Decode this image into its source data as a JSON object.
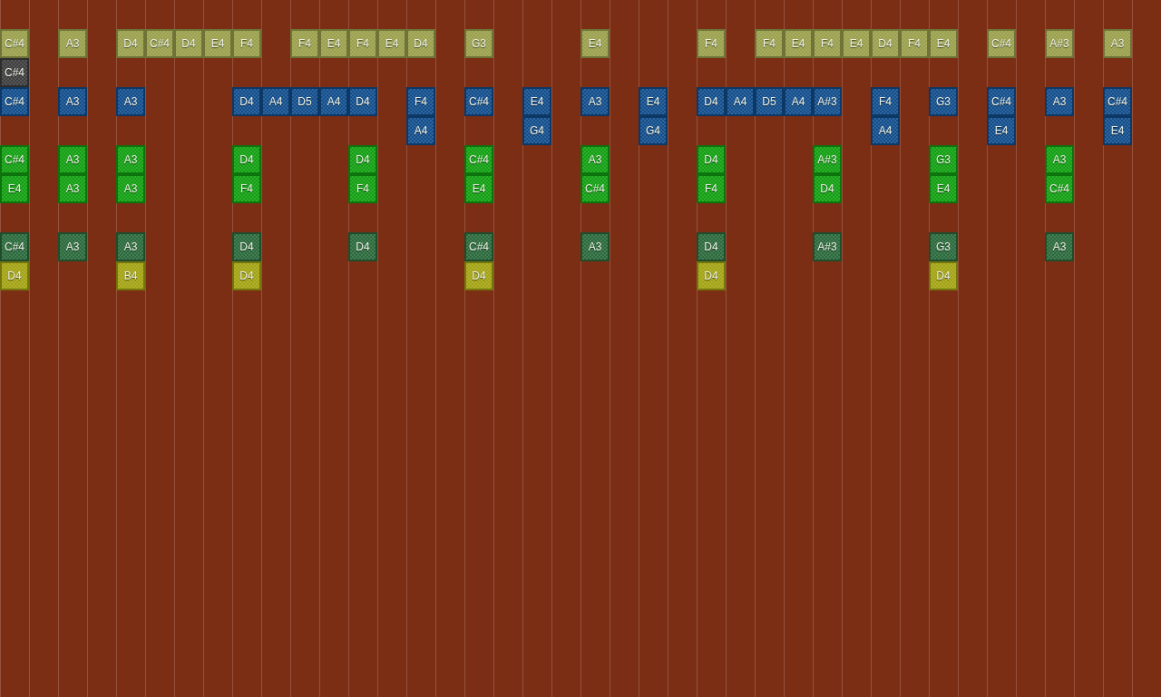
{
  "tracks": [
    {
      "color": "#9aa04c",
      "notes": [
        {
          "kind": "note",
          "pitch": "C#4"
        },
        {
          "kind": "rest"
        },
        {
          "kind": "note",
          "pitch": "A3"
        },
        {
          "kind": "rest"
        },
        {
          "kind": "note",
          "pitch": "D4"
        },
        {
          "kind": "note",
          "pitch": "C#4"
        },
        {
          "kind": "note",
          "pitch": "D4"
        },
        {
          "kind": "note",
          "pitch": "E4"
        },
        {
          "kind": "note",
          "pitch": "F4"
        },
        {
          "kind": "rest"
        },
        {
          "kind": "note",
          "pitch": "F4"
        },
        {
          "kind": "note",
          "pitch": "E4"
        },
        {
          "kind": "note",
          "pitch": "F4"
        },
        {
          "kind": "note",
          "pitch": "E4"
        },
        {
          "kind": "note",
          "pitch": "D4"
        },
        {
          "kind": "rest"
        },
        {
          "kind": "note",
          "pitch": "G3"
        },
        {
          "kind": "rest"
        },
        {
          "kind": "rest"
        },
        {
          "kind": "rest"
        },
        {
          "kind": "note",
          "pitch": "E4"
        },
        {
          "kind": "rest"
        },
        {
          "kind": "rest"
        },
        {
          "kind": "rest"
        },
        {
          "kind": "note",
          "pitch": "F4"
        },
        {
          "kind": "rest"
        },
        {
          "kind": "note",
          "pitch": "F4"
        },
        {
          "kind": "note",
          "pitch": "E4"
        },
        {
          "kind": "note",
          "pitch": "F4"
        },
        {
          "kind": "note",
          "pitch": "E4"
        },
        {
          "kind": "note",
          "pitch": "D4"
        },
        {
          "kind": "note",
          "pitch": "F4"
        },
        {
          "kind": "note",
          "pitch": "E4"
        },
        {
          "kind": "rest"
        },
        {
          "kind": "note",
          "pitch": "C#4"
        },
        {
          "kind": "rest"
        },
        {
          "kind": "note",
          "pitch": "A#3"
        },
        {
          "kind": "rest"
        },
        {
          "kind": "note",
          "pitch": "A3"
        }
      ]
    },
    {
      "color": "#3e3e3e",
      "notes": [
        {
          "kind": "note",
          "pitch": "C#4"
        }
      ]
    },
    {
      "color": "#124e8c",
      "notes": [
        {
          "kind": "note",
          "pitch": "C#4"
        },
        {
          "kind": "rest"
        },
        {
          "kind": "note",
          "pitch": "A3"
        },
        {
          "kind": "rest"
        },
        {
          "kind": "note",
          "pitch": "A3"
        },
        {
          "kind": "rest"
        },
        {
          "kind": "rest"
        },
        {
          "kind": "rest"
        },
        {
          "kind": "note",
          "pitch": "D4"
        },
        {
          "kind": "note",
          "pitch": "A4"
        },
        {
          "kind": "note",
          "pitch": "D5"
        },
        {
          "kind": "note",
          "pitch": "A4"
        },
        {
          "kind": "note",
          "pitch": "D4"
        },
        {
          "kind": "rest"
        },
        {
          "kind": "note",
          "pitch": "F4"
        },
        {
          "kind": "rest"
        },
        {
          "kind": "note",
          "pitch": "C#4"
        },
        {
          "kind": "rest"
        },
        {
          "kind": "note",
          "pitch": "E4"
        },
        {
          "kind": "rest"
        },
        {
          "kind": "note",
          "pitch": "A3"
        },
        {
          "kind": "rest"
        },
        {
          "kind": "note",
          "pitch": "E4"
        },
        {
          "kind": "rest"
        },
        {
          "kind": "note",
          "pitch": "D4"
        },
        {
          "kind": "note",
          "pitch": "A4"
        },
        {
          "kind": "note",
          "pitch": "D5"
        },
        {
          "kind": "note",
          "pitch": "A4"
        },
        {
          "kind": "note",
          "pitch": "A#3"
        },
        {
          "kind": "rest"
        },
        {
          "kind": "note",
          "pitch": "F4"
        },
        {
          "kind": "rest"
        },
        {
          "kind": "note",
          "pitch": "G3"
        },
        {
          "kind": "rest"
        },
        {
          "kind": "note",
          "pitch": "C#4"
        },
        {
          "kind": "rest"
        },
        {
          "kind": "note",
          "pitch": "A3"
        },
        {
          "kind": "rest"
        },
        {
          "kind": "note",
          "pitch": "C#4"
        }
      ]
    },
    {
      "color": "#124e8c",
      "notes": [
        {
          "kind": "rest"
        },
        {
          "kind": "rest"
        },
        {
          "kind": "rest"
        },
        {
          "kind": "rest"
        },
        {
          "kind": "rest"
        },
        {
          "kind": "rest"
        },
        {
          "kind": "rest"
        },
        {
          "kind": "rest"
        },
        {
          "kind": "rest"
        },
        {
          "kind": "rest"
        },
        {
          "kind": "rest"
        },
        {
          "kind": "rest"
        },
        {
          "kind": "rest"
        },
        {
          "kind": "rest"
        },
        {
          "kind": "note",
          "pitch": "A4"
        },
        {
          "kind": "rest"
        },
        {
          "kind": "rest"
        },
        {
          "kind": "rest"
        },
        {
          "kind": "note",
          "pitch": "G4"
        },
        {
          "kind": "rest"
        },
        {
          "kind": "rest"
        },
        {
          "kind": "rest"
        },
        {
          "kind": "note",
          "pitch": "G4"
        },
        {
          "kind": "rest"
        },
        {
          "kind": "rest"
        },
        {
          "kind": "rest"
        },
        {
          "kind": "rest"
        },
        {
          "kind": "rest"
        },
        {
          "kind": "rest"
        },
        {
          "kind": "rest"
        },
        {
          "kind": "note",
          "pitch": "A4"
        },
        {
          "kind": "rest"
        },
        {
          "kind": "rest"
        },
        {
          "kind": "rest"
        },
        {
          "kind": "note",
          "pitch": "E4"
        },
        {
          "kind": "rest"
        },
        {
          "kind": "rest"
        },
        {
          "kind": "rest"
        },
        {
          "kind": "note",
          "pitch": "E4"
        }
      ]
    },
    {
      "color": "#12a012",
      "notes": [
        {
          "kind": "note",
          "pitch": "C#4"
        },
        {
          "kind": "rest"
        },
        {
          "kind": "note",
          "pitch": "A3"
        },
        {
          "kind": "rest"
        },
        {
          "kind": "note",
          "pitch": "A3"
        },
        {
          "kind": "rest"
        },
        {
          "kind": "rest"
        },
        {
          "kind": "rest"
        },
        {
          "kind": "note",
          "pitch": "D4"
        },
        {
          "kind": "rest"
        },
        {
          "kind": "rest"
        },
        {
          "kind": "rest"
        },
        {
          "kind": "note",
          "pitch": "D4"
        },
        {
          "kind": "rest"
        },
        {
          "kind": "rest"
        },
        {
          "kind": "rest"
        },
        {
          "kind": "note",
          "pitch": "C#4"
        },
        {
          "kind": "rest"
        },
        {
          "kind": "rest"
        },
        {
          "kind": "rest"
        },
        {
          "kind": "note",
          "pitch": "A3"
        },
        {
          "kind": "rest"
        },
        {
          "kind": "rest"
        },
        {
          "kind": "rest"
        },
        {
          "kind": "note",
          "pitch": "D4"
        },
        {
          "kind": "rest"
        },
        {
          "kind": "rest"
        },
        {
          "kind": "rest"
        },
        {
          "kind": "note",
          "pitch": "A#3"
        },
        {
          "kind": "rest"
        },
        {
          "kind": "rest"
        },
        {
          "kind": "rest"
        },
        {
          "kind": "note",
          "pitch": "G3"
        },
        {
          "kind": "rest"
        },
        {
          "kind": "rest"
        },
        {
          "kind": "rest"
        },
        {
          "kind": "note",
          "pitch": "A3"
        }
      ]
    },
    {
      "color": "#12a012",
      "notes": [
        {
          "kind": "note",
          "pitch": "E4"
        },
        {
          "kind": "rest"
        },
        {
          "kind": "note",
          "pitch": "A3"
        },
        {
          "kind": "rest"
        },
        {
          "kind": "note",
          "pitch": "A3"
        },
        {
          "kind": "rest"
        },
        {
          "kind": "rest"
        },
        {
          "kind": "rest"
        },
        {
          "kind": "note",
          "pitch": "F4"
        },
        {
          "kind": "rest"
        },
        {
          "kind": "rest"
        },
        {
          "kind": "rest"
        },
        {
          "kind": "note",
          "pitch": "F4"
        },
        {
          "kind": "rest"
        },
        {
          "kind": "rest"
        },
        {
          "kind": "rest"
        },
        {
          "kind": "note",
          "pitch": "E4"
        },
        {
          "kind": "rest"
        },
        {
          "kind": "rest"
        },
        {
          "kind": "rest"
        },
        {
          "kind": "note",
          "pitch": "C#4"
        },
        {
          "kind": "rest"
        },
        {
          "kind": "rest"
        },
        {
          "kind": "rest"
        },
        {
          "kind": "note",
          "pitch": "F4"
        },
        {
          "kind": "rest"
        },
        {
          "kind": "rest"
        },
        {
          "kind": "rest"
        },
        {
          "kind": "note",
          "pitch": "D4"
        },
        {
          "kind": "rest"
        },
        {
          "kind": "rest"
        },
        {
          "kind": "rest"
        },
        {
          "kind": "note",
          "pitch": "E4"
        },
        {
          "kind": "rest"
        },
        {
          "kind": "rest"
        },
        {
          "kind": "rest"
        },
        {
          "kind": "note",
          "pitch": "C#4"
        }
      ]
    },
    {
      "notes": [
        {
          "kind": "rest"
        }
      ]
    },
    {
      "color": "#2b6a3c",
      "notes": [
        {
          "kind": "note",
          "pitch": "C#4"
        },
        {
          "kind": "rest"
        },
        {
          "kind": "note",
          "pitch": "A3"
        },
        {
          "kind": "rest"
        },
        {
          "kind": "note",
          "pitch": "A3"
        },
        {
          "kind": "rest"
        },
        {
          "kind": "rest"
        },
        {
          "kind": "rest"
        },
        {
          "kind": "note",
          "pitch": "D4"
        },
        {
          "kind": "rest"
        },
        {
          "kind": "rest"
        },
        {
          "kind": "rest"
        },
        {
          "kind": "note",
          "pitch": "D4"
        },
        {
          "kind": "rest"
        },
        {
          "kind": "rest"
        },
        {
          "kind": "rest"
        },
        {
          "kind": "note",
          "pitch": "C#4"
        },
        {
          "kind": "rest"
        },
        {
          "kind": "rest"
        },
        {
          "kind": "rest"
        },
        {
          "kind": "note",
          "pitch": "A3"
        },
        {
          "kind": "rest"
        },
        {
          "kind": "rest"
        },
        {
          "kind": "rest"
        },
        {
          "kind": "note",
          "pitch": "D4"
        },
        {
          "kind": "rest"
        },
        {
          "kind": "rest"
        },
        {
          "kind": "rest"
        },
        {
          "kind": "note",
          "pitch": "A#3"
        },
        {
          "kind": "rest"
        },
        {
          "kind": "rest"
        },
        {
          "kind": "rest"
        },
        {
          "kind": "note",
          "pitch": "G3"
        },
        {
          "kind": "rest"
        },
        {
          "kind": "rest"
        },
        {
          "kind": "rest"
        },
        {
          "kind": "note",
          "pitch": "A3"
        }
      ]
    },
    {
      "color": "#a3a314",
      "notes": [
        {
          "kind": "note",
          "pitch": "D4"
        },
        {
          "kind": "rest"
        },
        {
          "kind": "rest"
        },
        {
          "kind": "rest"
        },
        {
          "kind": "note",
          "pitch": "B4"
        },
        {
          "kind": "rest"
        },
        {
          "kind": "rest"
        },
        {
          "kind": "rest"
        },
        {
          "kind": "note",
          "pitch": "D4"
        },
        {
          "kind": "rest"
        },
        {
          "kind": "rest"
        },
        {
          "kind": "rest"
        },
        {
          "kind": "rest"
        },
        {
          "kind": "rest"
        },
        {
          "kind": "rest"
        },
        {
          "kind": "rest"
        },
        {
          "kind": "note",
          "pitch": "D4"
        },
        {
          "kind": "rest"
        },
        {
          "kind": "rest"
        },
        {
          "kind": "rest"
        },
        {
          "kind": "rest"
        },
        {
          "kind": "rest"
        },
        {
          "kind": "rest"
        },
        {
          "kind": "rest"
        },
        {
          "kind": "note",
          "pitch": "D4"
        },
        {
          "kind": "rest"
        },
        {
          "kind": "rest"
        },
        {
          "kind": "rest"
        },
        {
          "kind": "rest"
        },
        {
          "kind": "rest"
        },
        {
          "kind": "rest"
        },
        {
          "kind": "rest"
        },
        {
          "kind": "note",
          "pitch": "D4"
        }
      ]
    }
  ]
}
